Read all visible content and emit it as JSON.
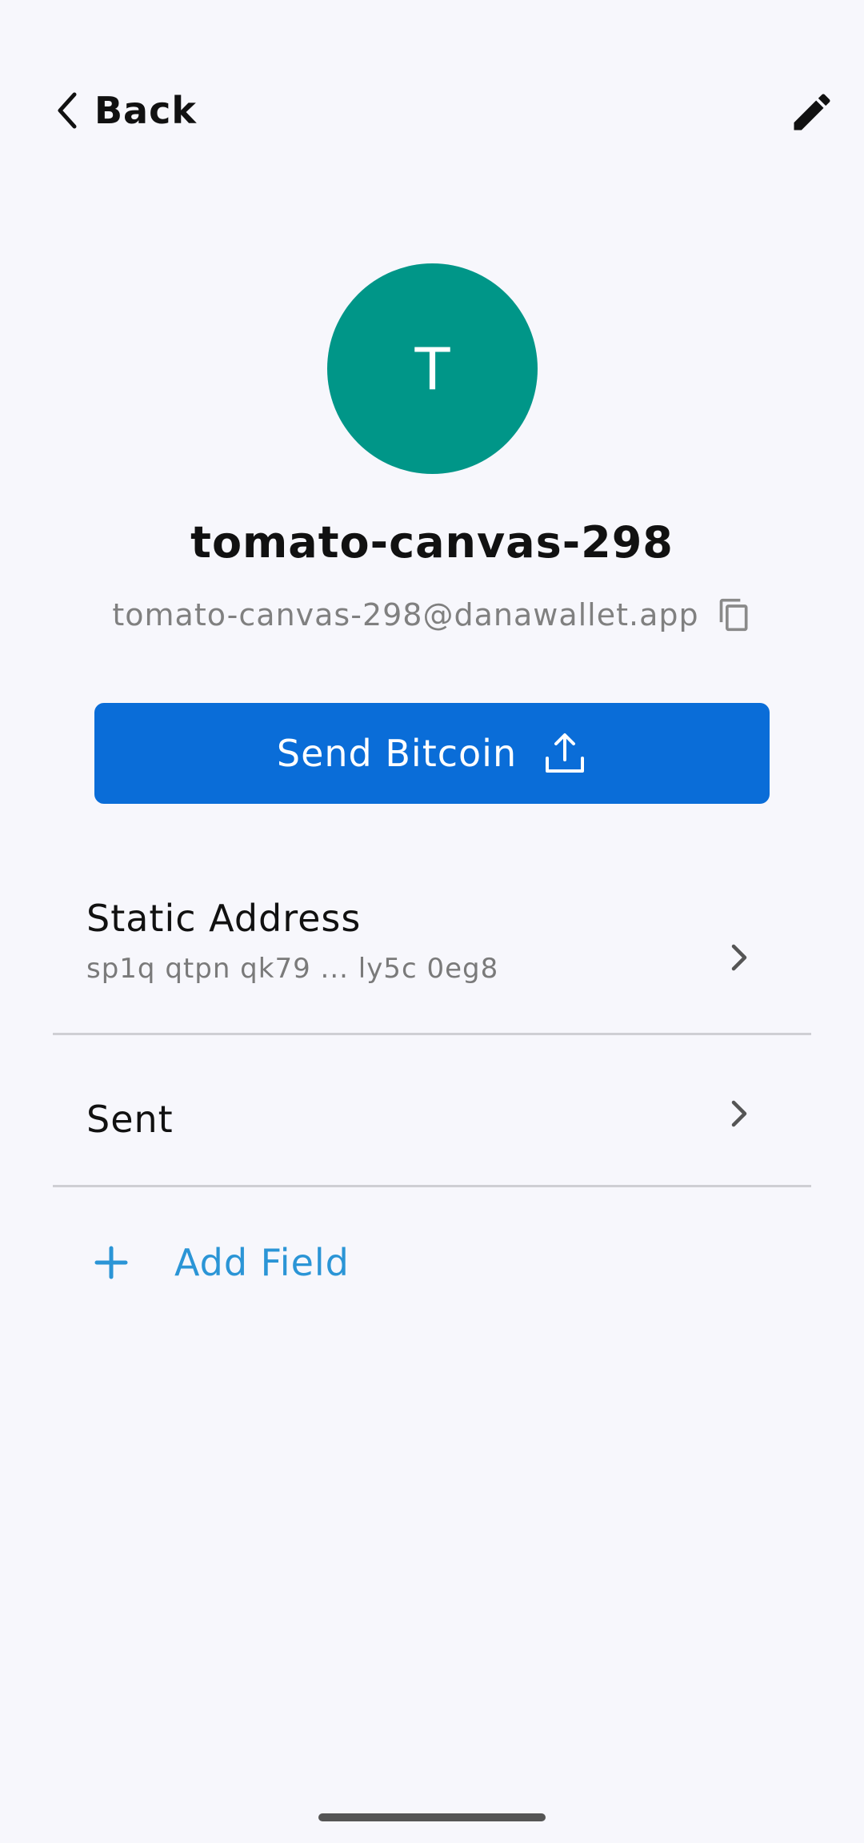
{
  "header": {
    "back_label": "Back",
    "back_icon": "chevron-left-icon",
    "edit_icon": "pencil-icon"
  },
  "contact": {
    "avatar_letter": "T",
    "avatar_color": "#009688",
    "name": "tomato-canvas-298",
    "address": "tomato-canvas-298@danawallet.app",
    "copy_icon": "copy-icon"
  },
  "actions": {
    "send_label": "Send Bitcoin",
    "send_color": "#0a6dd8",
    "send_icon": "upload-icon"
  },
  "fields": [
    {
      "title": "Static Address",
      "subtitle": "sp1q qtpn qk79 ... ly5c 0eg8"
    },
    {
      "title": "Sent"
    }
  ],
  "add_field": {
    "label": "Add Field",
    "color": "#2b95d6",
    "icon": "plus-icon"
  }
}
